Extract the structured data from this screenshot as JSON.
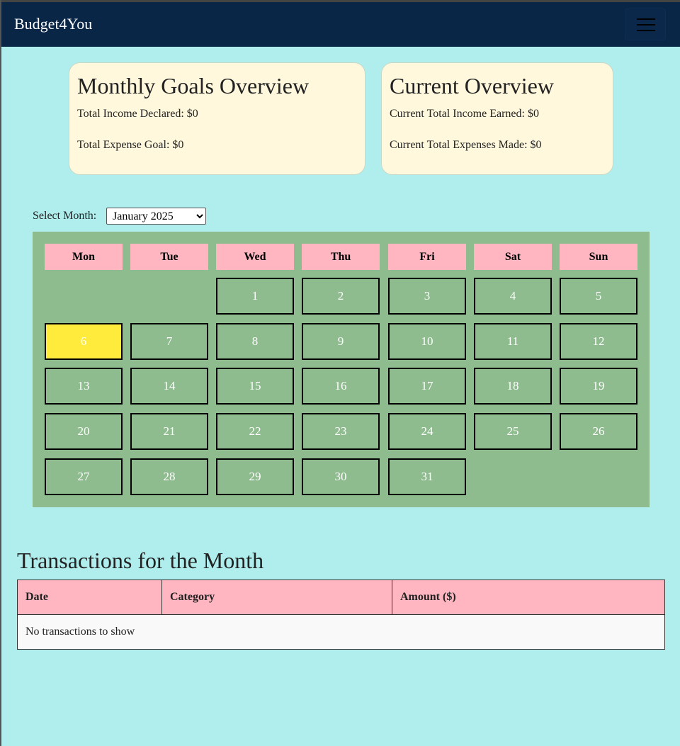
{
  "app": {
    "brand": "Budget4You"
  },
  "goals_card": {
    "title": "Monthly Goals Overview",
    "income_text": "Total Income Declared: $0",
    "expense_text": "Total Expense Goal: $0"
  },
  "current_card": {
    "title": "Current Overview",
    "income_text": "Current Total Income Earned: $0",
    "expense_text": "Current Total Expenses Made: $0"
  },
  "month_picker": {
    "label": "Select Month:",
    "selected": "January 2025"
  },
  "calendar": {
    "weekdays": [
      "Mon",
      "Tue",
      "Wed",
      "Thu",
      "Fri",
      "Sat",
      "Sun"
    ],
    "first_weekday_index": 2,
    "days_in_month": 31,
    "highlighted_day": 6
  },
  "transactions": {
    "title": "Transactions for the Month",
    "columns": [
      "Date",
      "Category",
      "Amount ($)"
    ],
    "empty_text": "No transactions to show"
  },
  "colors": {
    "navbar": "#0a2647",
    "page_bg": "#b0eeee",
    "card_bg": "#fff8dc",
    "calendar_bg": "#8fbc8f",
    "header_pink": "#ffb6c1",
    "today_yellow": "#ffeb3b"
  },
  "icons": {
    "menu": "hamburger-menu-icon"
  }
}
